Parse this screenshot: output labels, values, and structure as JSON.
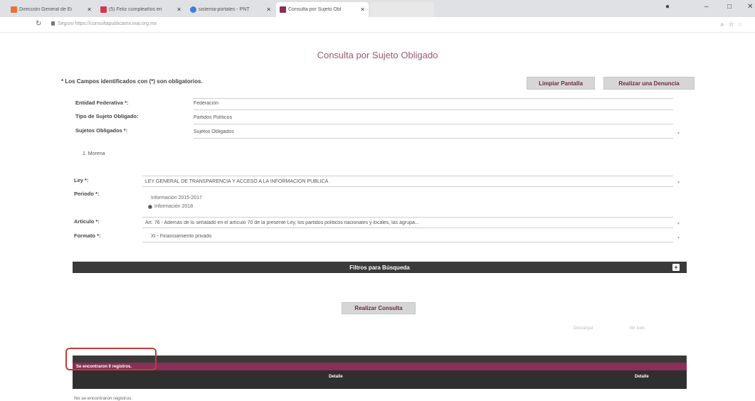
{
  "browser": {
    "tabs": [
      {
        "label": "Dirección General de Ei",
        "fav_color": "#e8733a"
      },
      {
        "label": "(5) Feliz cumpleaños en",
        "fav_color": "#d23a4f"
      },
      {
        "label": "sistema-portales - PNT",
        "fav_color": "#3f7fd6"
      },
      {
        "label": "Consulta por Sujeto Obl",
        "fav_color": "#8a2f55"
      }
    ],
    "url": "consultapublicamx.inai.org.mx",
    "url_prefix": "Seguro  https://"
  },
  "page": {
    "title": "Consulta por Sujeto Obligado",
    "required_note": "* Los Campos identificados con (*) son obligatorios.",
    "buttons": {
      "clear": "Limpiar Pantalla",
      "complaint": "Realizar una Denuncia",
      "search": "Realizar Consulta"
    }
  },
  "form": {
    "entidad_label": "Entidad Federativa *:",
    "entidad_value": "Federación",
    "tipo_label": "Tipo de Sujeto Obligado:",
    "tipo_value": "Partidos Políticos",
    "sujetos_label": "Sujetos Obligados *:",
    "sujetos_value": "Sujetos Obligados",
    "selected_item": "1. Morena",
    "ley_label": "Ley *:",
    "ley_value": "LEY GENERAL DE TRANSPARENCIA Y ACCESO A LA INFORMACIÓN PÚBLICA",
    "periodo_label": "Periodo *:",
    "periodo_options": [
      "Información 2015-2017",
      "Información 2018"
    ],
    "articulo_label": "Artículo *:",
    "articulo_value": "Art. 76 - Además de lo señalado en el artículo 70 de la presente Ley, los partidos políticos nacionales y locales, las agrupa...",
    "formato_label": "Formato *:",
    "formato_value": "XI - Financiamiento privado"
  },
  "filters": {
    "title": "Filtros para Búsqueda",
    "toggle_symbol": "+"
  },
  "pager": {
    "download": "Descargar",
    "expand": "Ver todo"
  },
  "results": {
    "count_text": "Se encontraron 0 registros.",
    "col_detail_1": "Detalle",
    "col_detail_2": "Detalle",
    "empty_text": "No se encontraron registros."
  }
}
